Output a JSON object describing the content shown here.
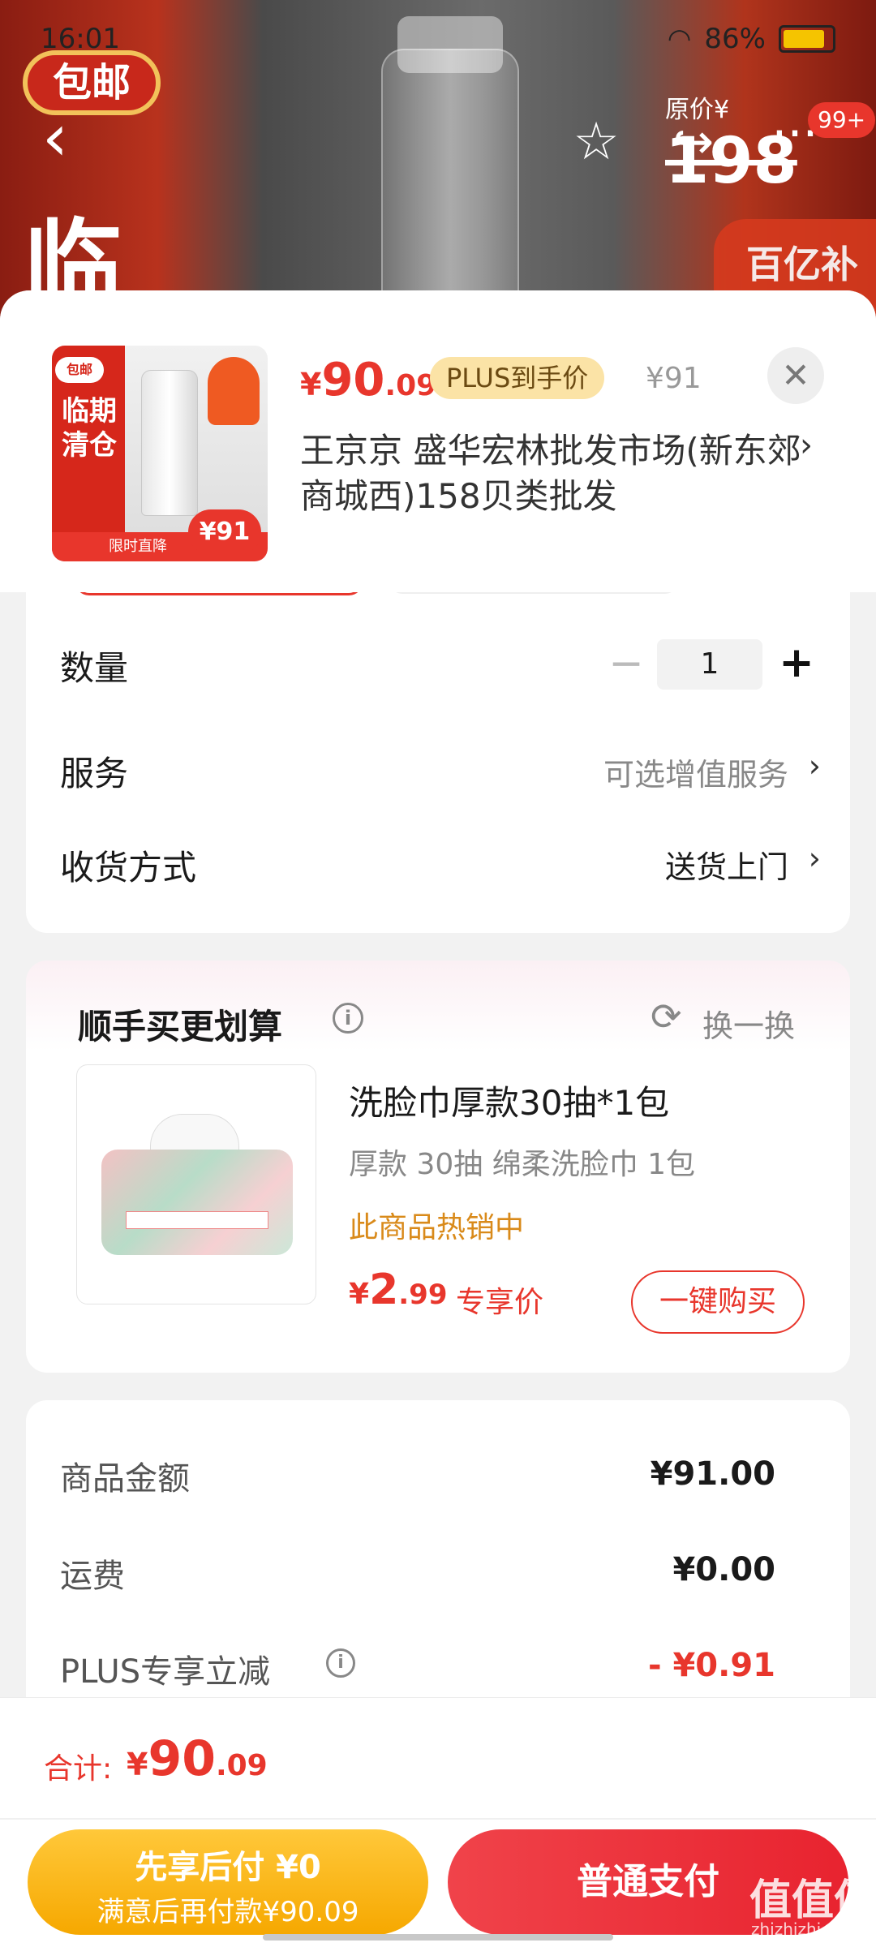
{
  "status_bar": {
    "time": "16:01",
    "battery": "86%"
  },
  "background": {
    "badge_left": "包邮",
    "big_char": "临",
    "price_label": "原价¥",
    "price_value": "198",
    "subsidy": "百亿补贴",
    "cart_badge": "99+"
  },
  "product": {
    "thumb_tag": "包邮",
    "thumb_text": "临期清仓",
    "thumb_flash": "限时直降",
    "thumb_price": "¥91",
    "price_yen": "¥",
    "price_int": "90",
    "price_dec": ".09",
    "plus_tag": "PLUS到手价",
    "original_price": "¥91",
    "shop": "王京京  盛华宏林批发市场(新东郊商城西)158贝类批发"
  },
  "options": {
    "quantity_label": "数量",
    "quantity_value": "1",
    "service_label": "服务",
    "service_value": "可选增值服务",
    "delivery_label": "收货方式",
    "delivery_value": "送货上门"
  },
  "addon": {
    "title": "顺手买更划算",
    "refresh": "换一换",
    "name": "洗脸巾厚款30抽*1包",
    "desc": "厚款 30抽 绵柔洗脸巾 1包",
    "hot": "此商品热销中",
    "price_yen": "¥",
    "price_int": "2",
    "price_dec": ".99",
    "price_tag": "专享价",
    "buy_label": "一键购买"
  },
  "fees": {
    "goods_label": "商品金额",
    "goods_value": "¥91.00",
    "shipping_label": "运费",
    "shipping_value": "¥0.00",
    "plus_label": "PLUS专享立减",
    "plus_value": "- ¥0.91"
  },
  "footer": {
    "total_label": "合计:",
    "total_yen": "¥",
    "total_int": "90",
    "total_dec": ".09",
    "later_line1": "先享后付 ¥0",
    "later_line2": "满意后再付款¥90.09",
    "normal_pay": "普通支付",
    "watermark": "值值值",
    "watermark_sub": "zhizhizhi.com"
  },
  "colors": {
    "accent": "#e8362c",
    "gold": "#f6a800",
    "hot": "#d98a1a"
  }
}
